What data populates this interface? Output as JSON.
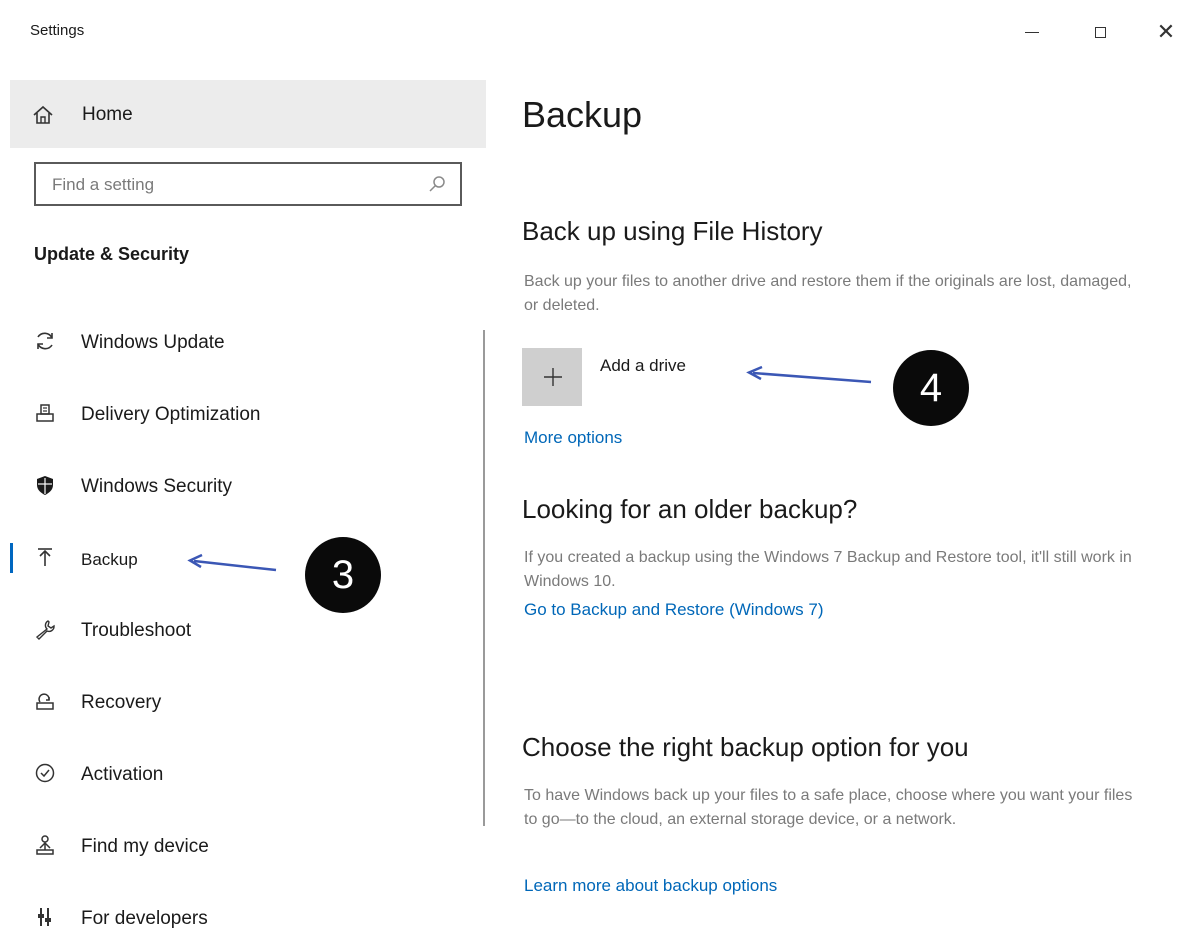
{
  "window": {
    "title": "Settings",
    "controls": {
      "minimize": "minimize",
      "maximize": "maximize",
      "close": "✕"
    }
  },
  "sidebar": {
    "home_label": "Home",
    "search_placeholder": "Find a setting",
    "section_heading": "Update & Security",
    "items": [
      {
        "label": "Windows Update",
        "icon": "refresh-icon"
      },
      {
        "label": "Delivery Optimization",
        "icon": "delivery-icon"
      },
      {
        "label": "Windows Security",
        "icon": "shield-icon"
      },
      {
        "label": "Backup",
        "icon": "upload-icon",
        "selected": true
      },
      {
        "label": "Troubleshoot",
        "icon": "wrench-icon"
      },
      {
        "label": "Recovery",
        "icon": "recovery-icon"
      },
      {
        "label": "Activation",
        "icon": "check-circle-icon"
      },
      {
        "label": "Find my device",
        "icon": "person-location-icon"
      },
      {
        "label": "For developers",
        "icon": "developer-icon"
      }
    ]
  },
  "main": {
    "title": "Backup",
    "file_history": {
      "heading": "Back up using File History",
      "description": "Back up your files to another drive and restore them if the originals are lost, damaged, or deleted.",
      "add_drive_label": "Add a drive",
      "more_options_link": "More options"
    },
    "older_backup": {
      "heading": "Looking for an older backup?",
      "description": "If you created a backup using the Windows 7 Backup and Restore tool, it'll still work in Windows 10.",
      "link": "Go to Backup and Restore (Windows 7)"
    },
    "choose_option": {
      "heading": "Choose the right backup option for you",
      "description": "To have Windows back up your files to a safe place, choose where you want your files to go—to the cloud, an external storage device, or a network.",
      "link": "Learn more about backup options"
    }
  },
  "annotations": {
    "step3": "3",
    "step4": "4"
  },
  "colors": {
    "accent": "#0067c0",
    "link": "#0067b8",
    "badge": "#0a0a0a",
    "arrow": "#3b57b5"
  }
}
